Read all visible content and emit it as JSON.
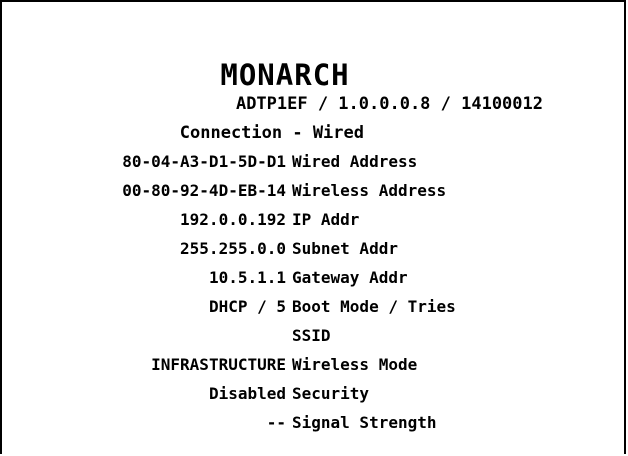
{
  "printout": {
    "title": "MONARCH",
    "subtitle": "ADTP1EF / 1.0.0.0.8 / 14100012",
    "connection": "Connection - Wired",
    "rows": [
      {
        "value": "80-04-A3-D1-5D-D1",
        "label": "Wired Address"
      },
      {
        "value": "00-80-92-4D-EB-14",
        "label": "Wireless Address"
      },
      {
        "value": "192.0.0.192",
        "label": "IP Addr"
      },
      {
        "value": "255.255.0.0",
        "label": "Subnet Addr"
      },
      {
        "value": "10.5.1.1",
        "label": "Gateway Addr"
      },
      {
        "value": "DHCP / 5",
        "label": "Boot Mode / Tries"
      },
      {
        "value": "",
        "label": "SSID"
      },
      {
        "value": "INFRASTRUCTURE",
        "label": "Wireless Mode"
      },
      {
        "value": "Disabled",
        "label": "Security"
      },
      {
        "value": "--",
        "label": "Signal Strength"
      }
    ]
  }
}
